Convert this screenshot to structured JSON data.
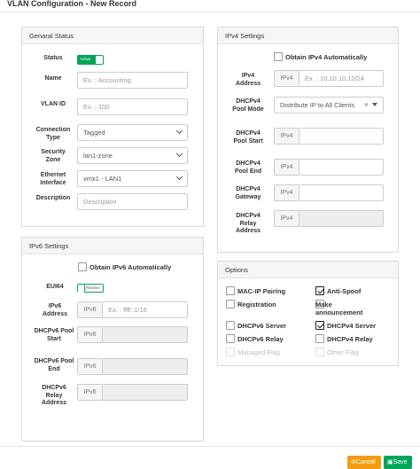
{
  "window": {
    "title": "VLAN Configuration - New Record"
  },
  "general": {
    "header": "Genaral Status",
    "status_label": "Status",
    "status_toggle": "Active",
    "name_label": "Name",
    "name_placeholder": "Ex. : Accounting",
    "vlan_label": "VLAN ID",
    "vlan_placeholder": "Ex. : 100",
    "conn_label": "Connection Type",
    "conn_value": "Tagged",
    "zone_label": "Security Zone",
    "zone_value": "lan1-zone",
    "eth_label": "Ethernet Interface",
    "eth_value": "vmx1 - LAN1",
    "desc_label": "Description",
    "desc_placeholder": "Description"
  },
  "ipv6": {
    "header": "IPv6 Settings",
    "auto_label": "Obtain IPv6 Automatically",
    "eui_label": "EUI64",
    "eui_toggle": "Passive",
    "addr_label": "IPv6 Address",
    "addr_addon": "IPv6",
    "addr_placeholder": "Ex. : ffff::1/16",
    "pool_start_label": "DHCPv6 Pool Start",
    "pool_start_addon": "IPv6",
    "pool_end_label": "DHCPv6 Pool End",
    "pool_end_addon": "IPv6",
    "relay_label": "DHCPv6 Relay Address",
    "relay_addon": "IPv6"
  },
  "ipv4": {
    "header": "IPv4 Settings",
    "auto_label": "Obtain IPv4 Automatically",
    "addr_label": "IPv4 Address",
    "addr_addon": "IPv4",
    "addr_placeholder": "Ex. : 10.10.10.10/24",
    "pool_mode_label": "DHCPv4 Pool Mode",
    "pool_mode_value": "Distribute IP to All Clients",
    "pool_start_label": "DHCPv4 Pool Start",
    "pool_start_addon": "IPv4",
    "pool_end_label": "DHCPv4 Pool End",
    "pool_end_addon": "IPv4",
    "gateway_label": "DHCPv4 Gateway",
    "gateway_addon": "IPv4",
    "relay_label": "DHCPv4 Relay Address",
    "relay_addon": "IPv4"
  },
  "options": {
    "header": "Options",
    "items": [
      {
        "label": "MAC-IP Pairing",
        "checked": false,
        "disabled": false
      },
      {
        "label": "Anti-Spoof",
        "checked": true,
        "disabled": false
      },
      {
        "label": "Registration",
        "checked": false,
        "disabled": false
      },
      {
        "label": "Make announcement",
        "checked": false,
        "disabled": false
      },
      {
        "label": "DHCPv6 Server",
        "checked": false,
        "disabled": false
      },
      {
        "label": "DHCPv4 Server",
        "checked": true,
        "disabled": false
      },
      {
        "label": "DHCPv6 Relay",
        "checked": false,
        "disabled": false
      },
      {
        "label": "DHCPv4 Relay",
        "checked": false,
        "disabled": false
      },
      {
        "label": "Managed Flag",
        "checked": false,
        "disabled": true
      },
      {
        "label": "Other Flag",
        "checked": false,
        "disabled": true
      }
    ]
  },
  "footer": {
    "cancel_label": "Cancel",
    "save_label": "Save"
  },
  "colors": {
    "toggle_on": "#00a65a",
    "save": "#00a65a",
    "cancel": "#f39c12"
  }
}
